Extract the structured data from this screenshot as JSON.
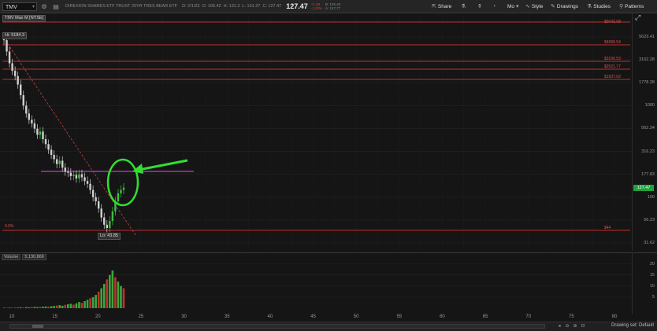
{
  "header": {
    "symbol": "TMV",
    "description": "DIREXION SHARES ETF TRUST 20YR TRES BEAR ETF",
    "date": "D: 2/1/23",
    "open": "O: 106.42",
    "high": "H: 131.3",
    "low": "L: 101.27",
    "close": "C: 127.47",
    "last": "127.47",
    "change_line1": "+1.59",
    "change_line2": "-1.23%",
    "bid": "B: 125.40",
    "ask": "A: 127.77"
  },
  "toolbar": {
    "share": "Share",
    "mo": "Mo",
    "style": "Style",
    "drawings": "Drawings",
    "studies": "Studies",
    "patterns": "Patterns"
  },
  "chart_label": "TMV Max M [NYSE]",
  "hi_label": "Hi: 5184.3",
  "lo_label": "Lo: 43.85",
  "volume_label": "Volume",
  "volume_value": "5,130,866",
  "status": {
    "drawing_set": "Drawing set: Default"
  },
  "price_axis": [
    "5623.41",
    "3162.28",
    "1778.28",
    "1000",
    "562.34",
    "316.23",
    "177.83",
    "100",
    "56.23",
    "31.62"
  ],
  "last_price_badge": "127.47",
  "fib_levels": [
    {
      "pct": "",
      "price": "$5042.08"
    },
    {
      "pct": "",
      "price": "$4999.54"
    },
    {
      "pct": "",
      "price": "$3106.53"
    },
    {
      "pct": "",
      "price": "$2521.77"
    },
    {
      "pct": "",
      "price": "$1937.02"
    },
    {
      "pct": "0.0%",
      "price": "$44"
    }
  ],
  "volume_axis": [
    "20",
    "15",
    "10",
    "5"
  ],
  "x_axis": [
    "10",
    "15",
    "20",
    "25",
    "30",
    "35",
    "40",
    "45",
    "50",
    "55",
    "60",
    "65",
    "70",
    "75",
    "80"
  ],
  "colors": {
    "up": "#3fbf3f",
    "down": "#d0d0d0",
    "fib": "#c03030",
    "trend": "#c84040",
    "horizontal": "#c040c0",
    "annotation": "#33dd33",
    "volume_up": "#3aa83a",
    "volume_down": "#c03030",
    "last_badge": "#1fa33a"
  },
  "annotations": {
    "circle": "green-circle",
    "arrow": "green-arrow"
  }
}
